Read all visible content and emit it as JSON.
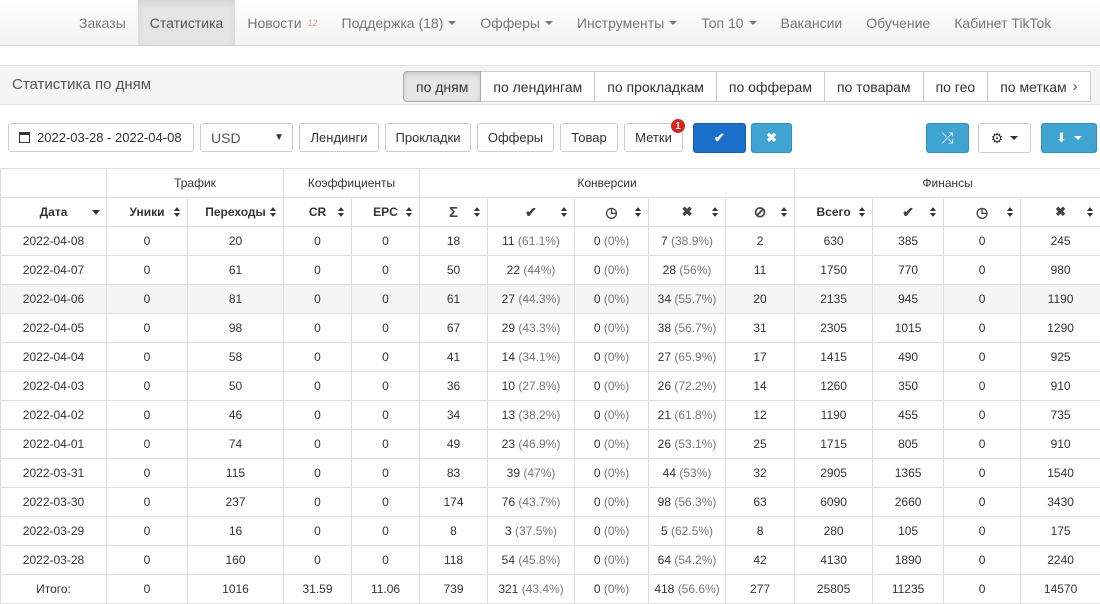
{
  "nav": {
    "items": [
      {
        "label": "Заказы",
        "caret": false
      },
      {
        "label": "Статистика",
        "caret": false,
        "active": true
      },
      {
        "label": "Новости",
        "caret": false,
        "badge": "12"
      },
      {
        "label": "Поддержка (18)",
        "caret": true
      },
      {
        "label": "Офферы",
        "caret": true
      },
      {
        "label": "Инструменты",
        "caret": true
      },
      {
        "label": "Топ 10",
        "caret": true
      },
      {
        "label": "Вакансии",
        "caret": false
      },
      {
        "label": "Обучение",
        "caret": false
      },
      {
        "label": "Кабинет TikTok",
        "caret": false
      }
    ]
  },
  "subbar": {
    "title": "Статистика по дням",
    "tabs": [
      "по дням",
      "по лендингам",
      "по прокладкам",
      "по офферам",
      "по товарам",
      "по гео",
      "по меткам"
    ]
  },
  "filters": {
    "date_range": "2022-03-28 - 2022-04-08",
    "currency": "USD",
    "landings": "Лендинги",
    "prokladki": "Прокладки",
    "offers": "Офферы",
    "product": "Товар",
    "tags": "Метки",
    "tags_badge": "1",
    "apply_icon": "✔",
    "reset_icon": "✖",
    "shuffle_icon": "⤮",
    "gear_icon": "⚙",
    "download_icon": "⬇"
  },
  "table": {
    "groups": {
      "traffic": "Трафик",
      "coeffs": "Коэффициенты",
      "conversions": "Конверсии",
      "finance": "Финансы"
    },
    "columns": {
      "date": "Дата",
      "uniques": "Уники",
      "clicks": "Переходы",
      "cr": "CR",
      "epc": "EPC",
      "sum_icon": "Σ",
      "approved_icon": "✔",
      "hold_icon": "◷",
      "rejected_icon": "✖",
      "trash_icon": "⊘",
      "fin_total": "Всего",
      "fin_approved_icon": "✔",
      "fin_hold_icon": "◷",
      "fin_rejected_icon": "✖"
    },
    "rows": [
      {
        "date": "2022-04-08",
        "uniques": "0",
        "clicks": "20",
        "cr": "0",
        "epc": "0",
        "sum": "18",
        "approved": "11",
        "approved_pct": "(61.1%)",
        "hold": "0",
        "hold_pct": "(0%)",
        "rejected": "7",
        "rejected_pct": "(38.9%)",
        "trash": "2",
        "fin_total": "630",
        "fin_approved": "385",
        "fin_hold": "0",
        "fin_rejected": "245"
      },
      {
        "date": "2022-04-07",
        "uniques": "0",
        "clicks": "61",
        "cr": "0",
        "epc": "0",
        "sum": "50",
        "approved": "22",
        "approved_pct": "(44%)",
        "hold": "0",
        "hold_pct": "(0%)",
        "rejected": "28",
        "rejected_pct": "(56%)",
        "trash": "11",
        "fin_total": "1750",
        "fin_approved": "770",
        "fin_hold": "0",
        "fin_rejected": "980"
      },
      {
        "date": "2022-04-06",
        "uniques": "0",
        "clicks": "81",
        "cr": "0",
        "epc": "0",
        "sum": "61",
        "approved": "27",
        "approved_pct": "(44.3%)",
        "hold": "0",
        "hold_pct": "(0%)",
        "rejected": "34",
        "rejected_pct": "(55.7%)",
        "trash": "20",
        "fin_total": "2135",
        "fin_approved": "945",
        "fin_hold": "0",
        "fin_rejected": "1190"
      },
      {
        "date": "2022-04-05",
        "uniques": "0",
        "clicks": "98",
        "cr": "0",
        "epc": "0",
        "sum": "67",
        "approved": "29",
        "approved_pct": "(43.3%)",
        "hold": "0",
        "hold_pct": "(0%)",
        "rejected": "38",
        "rejected_pct": "(56.7%)",
        "trash": "31",
        "fin_total": "2305",
        "fin_approved": "1015",
        "fin_hold": "0",
        "fin_rejected": "1290"
      },
      {
        "date": "2022-04-04",
        "uniques": "0",
        "clicks": "58",
        "cr": "0",
        "epc": "0",
        "sum": "41",
        "approved": "14",
        "approved_pct": "(34.1%)",
        "hold": "0",
        "hold_pct": "(0%)",
        "rejected": "27",
        "rejected_pct": "(65.9%)",
        "trash": "17",
        "fin_total": "1415",
        "fin_approved": "490",
        "fin_hold": "0",
        "fin_rejected": "925"
      },
      {
        "date": "2022-04-03",
        "uniques": "0",
        "clicks": "50",
        "cr": "0",
        "epc": "0",
        "sum": "36",
        "approved": "10",
        "approved_pct": "(27.8%)",
        "hold": "0",
        "hold_pct": "(0%)",
        "rejected": "26",
        "rejected_pct": "(72.2%)",
        "trash": "14",
        "fin_total": "1260",
        "fin_approved": "350",
        "fin_hold": "0",
        "fin_rejected": "910"
      },
      {
        "date": "2022-04-02",
        "uniques": "0",
        "clicks": "46",
        "cr": "0",
        "epc": "0",
        "sum": "34",
        "approved": "13",
        "approved_pct": "(38.2%)",
        "hold": "0",
        "hold_pct": "(0%)",
        "rejected": "21",
        "rejected_pct": "(61.8%)",
        "trash": "12",
        "fin_total": "1190",
        "fin_approved": "455",
        "fin_hold": "0",
        "fin_rejected": "735"
      },
      {
        "date": "2022-04-01",
        "uniques": "0",
        "clicks": "74",
        "cr": "0",
        "epc": "0",
        "sum": "49",
        "approved": "23",
        "approved_pct": "(46.9%)",
        "hold": "0",
        "hold_pct": "(0%)",
        "rejected": "26",
        "rejected_pct": "(53.1%)",
        "trash": "25",
        "fin_total": "1715",
        "fin_approved": "805",
        "fin_hold": "0",
        "fin_rejected": "910"
      },
      {
        "date": "2022-03-31",
        "uniques": "0",
        "clicks": "115",
        "cr": "0",
        "epc": "0",
        "sum": "83",
        "approved": "39",
        "approved_pct": "(47%)",
        "hold": "0",
        "hold_pct": "(0%)",
        "rejected": "44",
        "rejected_pct": "(53%)",
        "trash": "32",
        "fin_total": "2905",
        "fin_approved": "1365",
        "fin_hold": "0",
        "fin_rejected": "1540"
      },
      {
        "date": "2022-03-30",
        "uniques": "0",
        "clicks": "237",
        "cr": "0",
        "epc": "0",
        "sum": "174",
        "approved": "76",
        "approved_pct": "(43.7%)",
        "hold": "0",
        "hold_pct": "(0%)",
        "rejected": "98",
        "rejected_pct": "(56.3%)",
        "trash": "63",
        "fin_total": "6090",
        "fin_approved": "2660",
        "fin_hold": "0",
        "fin_rejected": "3430"
      },
      {
        "date": "2022-03-29",
        "uniques": "0",
        "clicks": "16",
        "cr": "0",
        "epc": "0",
        "sum": "8",
        "approved": "3",
        "approved_pct": "(37.5%)",
        "hold": "0",
        "hold_pct": "(0%)",
        "rejected": "5",
        "rejected_pct": "(62.5%)",
        "trash": "8",
        "fin_total": "280",
        "fin_approved": "105",
        "fin_hold": "0",
        "fin_rejected": "175"
      },
      {
        "date": "2022-03-28",
        "uniques": "0",
        "clicks": "160",
        "cr": "0",
        "epc": "0",
        "sum": "118",
        "approved": "54",
        "approved_pct": "(45.8%)",
        "hold": "0",
        "hold_pct": "(0%)",
        "rejected": "64",
        "rejected_pct": "(54.2%)",
        "trash": "42",
        "fin_total": "4130",
        "fin_approved": "1890",
        "fin_hold": "0",
        "fin_rejected": "2240"
      }
    ],
    "totals": {
      "date": "Итого:",
      "uniques": "0",
      "clicks": "1016",
      "cr": "31.59",
      "epc": "11.06",
      "sum": "739",
      "approved": "321",
      "approved_pct": "(43.4%)",
      "hold": "0",
      "hold_pct": "(0%)",
      "rejected": "418",
      "rejected_pct": "(56.6%)",
      "trash": "277",
      "fin_total": "25805",
      "fin_approved": "11235",
      "fin_hold": "0",
      "fin_rejected": "14570"
    }
  }
}
